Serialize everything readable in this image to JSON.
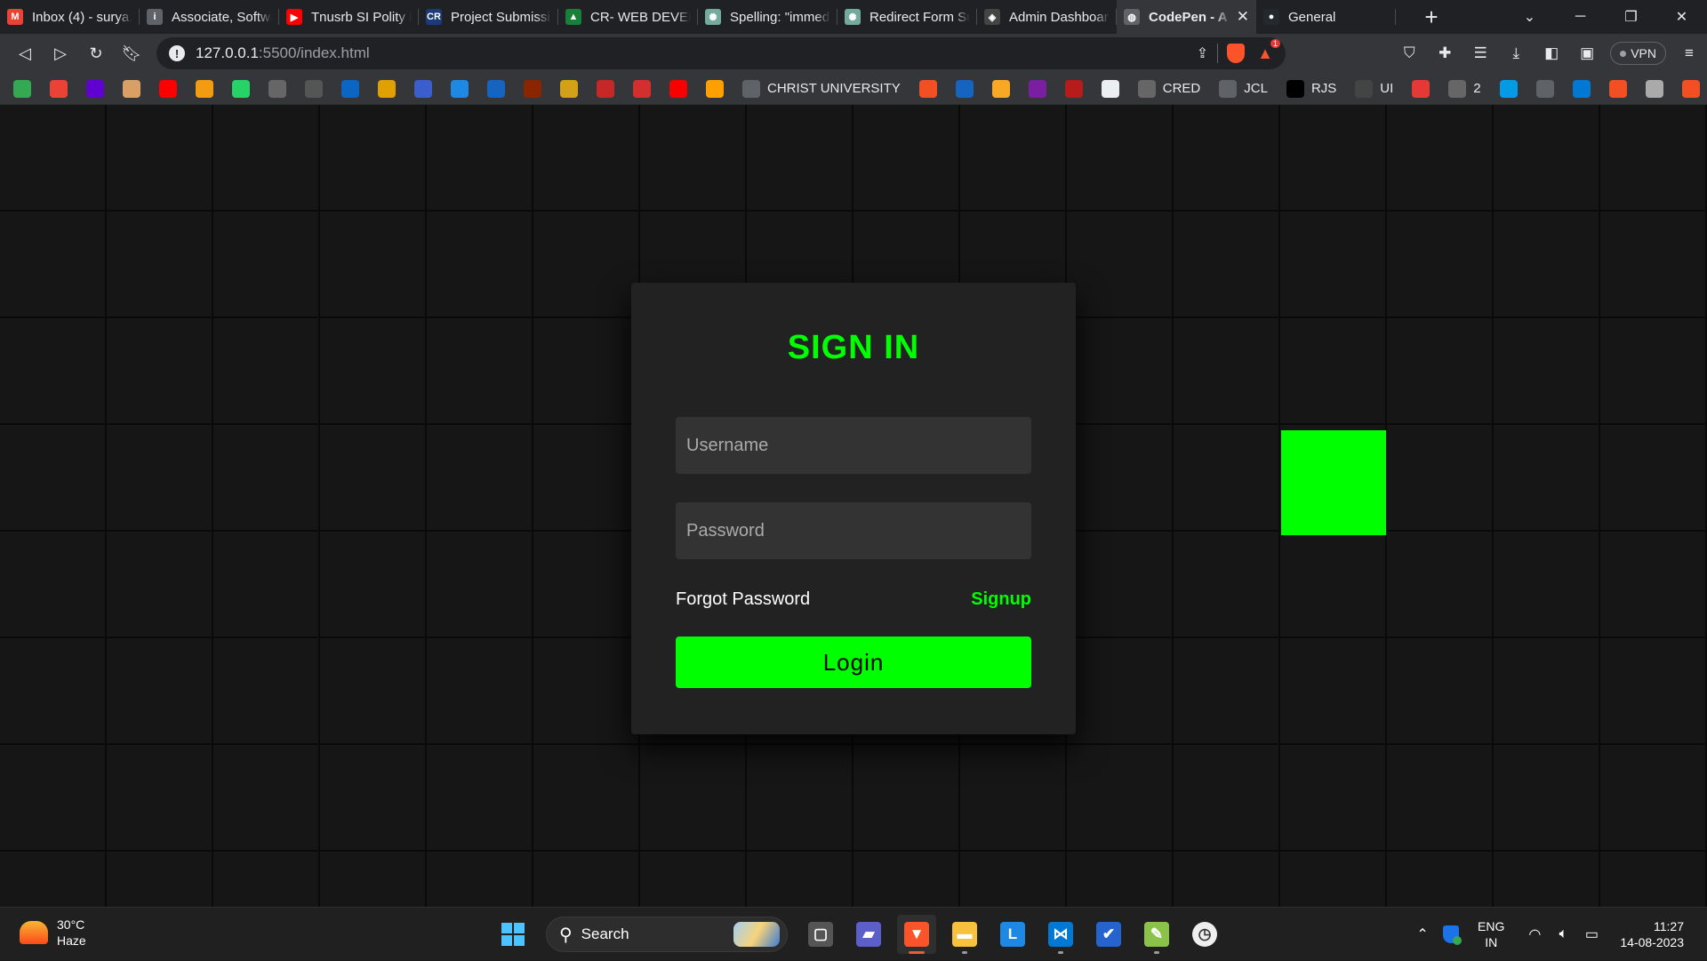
{
  "browser": {
    "tabs": [
      {
        "title": "Inbox (4) - surya.",
        "icon": "gmail-icon",
        "color": "#ea4335",
        "glyph": "M",
        "active": false
      },
      {
        "title": "Associate, Softwa",
        "icon": "info-icon",
        "color": "#5f6368",
        "glyph": "i",
        "active": false
      },
      {
        "title": "Tnusrb SI Polity P",
        "icon": "youtube-icon",
        "color": "#ff0000",
        "glyph": "▶",
        "active": false
      },
      {
        "title": "Project Submissic",
        "icon": "cr-icon",
        "color": "#1a3a7a",
        "glyph": "CR",
        "active": false
      },
      {
        "title": "CR- WEB DEVELC",
        "icon": "google-drive-icon",
        "color": "#188038",
        "glyph": "▲",
        "active": false
      },
      {
        "title": "Spelling: \"immed",
        "icon": "chatgpt-icon",
        "color": "#74aa9c",
        "glyph": "✺",
        "active": false
      },
      {
        "title": "Redirect Form Su",
        "icon": "chatgpt-icon",
        "color": "#74aa9c",
        "glyph": "✺",
        "active": false
      },
      {
        "title": "Admin Dashboar",
        "icon": "codepen-icon",
        "color": "#444",
        "glyph": "◈",
        "active": false
      },
      {
        "title": "CodePen - A",
        "icon": "globe-icon",
        "color": "#5f6368",
        "glyph": "◍",
        "active": true
      },
      {
        "title": "General",
        "icon": "github-icon",
        "color": "#24292e",
        "glyph": "●",
        "active": false
      }
    ],
    "new_tab": "+",
    "address": {
      "host": "127.0.0.1",
      "path": ":5500/index.html"
    },
    "vpn_label": "VPN",
    "notification_badge": "1",
    "bookmarks": [
      {
        "icon": "google-photos-icon",
        "color": "#34a853",
        "label": ""
      },
      {
        "icon": "gmail-icon",
        "color": "#ea4335",
        "label": ""
      },
      {
        "icon": "yahoo-mail-icon",
        "color": "#6001d2",
        "label": ""
      },
      {
        "icon": "bookmark-circle-icon",
        "color": "#d9a066",
        "label": ""
      },
      {
        "icon": "youtube-icon",
        "color": "#ff0000",
        "label": ""
      },
      {
        "icon": "naukri-icon",
        "color": "#f39c12",
        "label": ""
      },
      {
        "icon": "whatsapp-icon",
        "color": "#25d366",
        "label": ""
      },
      {
        "icon": "network-icon",
        "color": "#666",
        "label": ""
      },
      {
        "icon": "github-icon",
        "color": "#555",
        "label": ""
      },
      {
        "icon": "linkedin-icon",
        "color": "#0a66c2",
        "label": ""
      },
      {
        "icon": "arc-icon",
        "color": "#e0a000",
        "label": ""
      },
      {
        "icon": "blue-app-icon",
        "color": "#3a5fcd",
        "label": ""
      },
      {
        "icon": "upwork-icon",
        "color": "#1e88e5",
        "label": ""
      },
      {
        "icon": "fc-icon",
        "color": "#1565c0",
        "label": ""
      },
      {
        "icon": "movie-icon",
        "color": "#8b2500",
        "label": ""
      },
      {
        "icon": "gold-seal-icon",
        "color": "#d4a017",
        "label": ""
      },
      {
        "icon": "tg-icon",
        "color": "#c62828",
        "label": ""
      },
      {
        "icon": "news-icon",
        "color": "#d32f2f",
        "label": ""
      },
      {
        "icon": "oracle-icon",
        "color": "#f80000",
        "label": ""
      },
      {
        "icon": "firebase-icon",
        "color": "#ffa000",
        "label": ""
      },
      {
        "icon": "globe-icon",
        "color": "#5f6368",
        "label": "CHRIST UNIVERSITY"
      },
      {
        "icon": "microsoft-icon",
        "color": "#f25022",
        "label": ""
      },
      {
        "icon": "blue-gem-icon",
        "color": "#1565c0",
        "label": ""
      },
      {
        "icon": "bars-icon",
        "color": "#f9a825",
        "label": ""
      },
      {
        "icon": "purple-u-icon",
        "color": "#7b1fa2",
        "label": ""
      },
      {
        "icon": "red-logo-icon",
        "color": "#b71c1c",
        "label": ""
      },
      {
        "icon": "jr-icon",
        "color": "#eceff1",
        "label": ""
      },
      {
        "icon": "network-icon",
        "color": "#666",
        "label": "CRED"
      },
      {
        "icon": "globe-icon",
        "color": "#5f6368",
        "label": "JCL"
      },
      {
        "icon": "r-icon",
        "color": "#000",
        "label": "RJS"
      },
      {
        "icon": "font-icon",
        "color": "#444",
        "label": "UI"
      },
      {
        "icon": "red-check-icon",
        "color": "#e53935",
        "label": ""
      },
      {
        "icon": "network-icon",
        "color": "#666",
        "label": "2"
      },
      {
        "icon": "is-icon",
        "color": "#039be5",
        "label": ""
      },
      {
        "icon": "globe-icon",
        "color": "#5f6368",
        "label": ""
      },
      {
        "icon": "azure-icon",
        "color": "#0078d4",
        "label": ""
      },
      {
        "icon": "microsoft-icon",
        "color": "#f25022",
        "label": ""
      },
      {
        "icon": "image-icon",
        "color": "#aaa",
        "label": ""
      },
      {
        "icon": "microsoft-icon",
        "color": "#f25022",
        "label": ""
      }
    ],
    "bookmarks_more": "»"
  },
  "page": {
    "title": "SIGN IN",
    "username_placeholder": "Username",
    "password_placeholder": "Password",
    "forgot_password": "Forgot Password",
    "signup": "Signup",
    "login_button": "Login",
    "accent": "#00ff00"
  },
  "taskbar": {
    "weather_temp": "30°C",
    "weather_desc": "Haze",
    "search_label": "Search",
    "language_top": "ENG",
    "language_bottom": "IN",
    "time": "11:27",
    "date": "14-08-2023",
    "apps": [
      {
        "name": "task-view-icon",
        "color": "#555",
        "glyph": "▢"
      },
      {
        "name": "teams-chat-icon",
        "color": "#5b5fc7",
        "glyph": "▰"
      },
      {
        "name": "brave-browser-icon",
        "color": "#fb542b",
        "glyph": "▼"
      },
      {
        "name": "file-explorer-icon",
        "color": "#f8c13d",
        "glyph": "▬"
      },
      {
        "name": "l-app-icon",
        "color": "#1e88e5",
        "glyph": "L"
      },
      {
        "name": "vscode-icon",
        "color": "#0078d4",
        "glyph": "⋈"
      },
      {
        "name": "todo-icon",
        "color": "#2564cf",
        "glyph": "✔"
      },
      {
        "name": "notepad-icon",
        "color": "#8bc34a",
        "glyph": "✎"
      },
      {
        "name": "clock-app-icon",
        "color": "#eee",
        "glyph": "◷"
      }
    ]
  }
}
